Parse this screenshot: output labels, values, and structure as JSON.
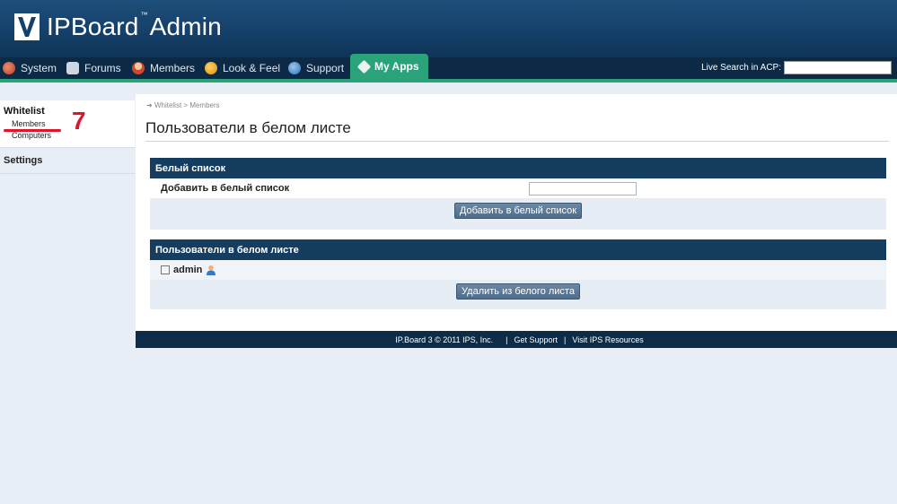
{
  "header": {
    "logo_text": "IPBoard",
    "logo_tm": "™",
    "logo_suffix": "Admin"
  },
  "nav": {
    "items": [
      {
        "label": "System",
        "icon": "system-icon"
      },
      {
        "label": "Forums",
        "icon": "forums-icon"
      },
      {
        "label": "Members",
        "icon": "members-icon"
      },
      {
        "label": "Look & Feel",
        "icon": "look-feel-icon"
      },
      {
        "label": "Support",
        "icon": "support-icon"
      },
      {
        "label": "My Apps",
        "icon": "my-apps-icon",
        "active": true
      }
    ],
    "live_search_label": "Live Search in ACP:",
    "live_search_value": ""
  },
  "sidebar": {
    "section_title": "Whitelist",
    "links": [
      "Members",
      "Computers"
    ],
    "settings_label": "Settings",
    "annotation_number": "7"
  },
  "main": {
    "breadcrumb": [
      "Whitelist",
      ">",
      "Members"
    ],
    "page_title": "Пользователи в белом листе",
    "add_panel": {
      "title": "Белый список",
      "field_label": "Добавить в белый список",
      "field_value": "",
      "button_label": "Добавить в белый список"
    },
    "users_panel": {
      "title": "Пользователи в белом листе",
      "users": [
        {
          "name": "admin"
        }
      ],
      "button_label": "Удалить из белого листа"
    }
  },
  "footer": {
    "copyright": "IP.Board 3 © 2011 IPS, Inc.",
    "sep": "|",
    "link1": "Get Support",
    "link2": "Visit IPS Resources"
  },
  "colors": {
    "header_bg": "#154069",
    "nav_bg": "#0c2a45",
    "accent_green": "#2aa37b",
    "panel_head": "#143d5f",
    "annotation_red": "#e0142b"
  }
}
